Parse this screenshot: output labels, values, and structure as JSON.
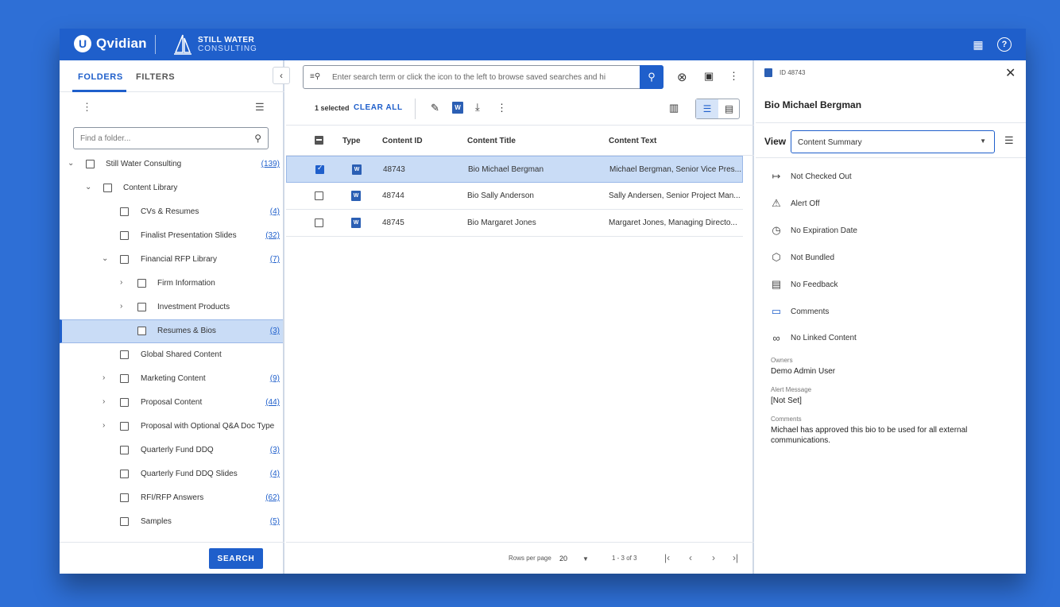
{
  "topbar": {
    "brand": "Qvidian",
    "brand_mark": "U",
    "client_line1": "STILL WATER",
    "client_line2": "CONSULTING",
    "icons": [
      "building-icon",
      "help-icon"
    ]
  },
  "left": {
    "tabs": [
      "FOLDERS",
      "FILTERS"
    ],
    "find_placeholder": "Find a folder...",
    "tree": [
      {
        "label": "Still Water Consulting",
        "count": "(139)",
        "chev": "⌄"
      },
      {
        "label": "Content Library",
        "count": "",
        "chev": "⌄"
      },
      {
        "label": "CVs & Resumes",
        "count": "(4)",
        "chev": ""
      },
      {
        "label": "Finalist Presentation Slides",
        "count": "(32)",
        "chev": ""
      },
      {
        "label": "Financial RFP Library",
        "count": "(7)",
        "chev": "⌄"
      },
      {
        "label": "Firm Information",
        "count": "",
        "chev": "›"
      },
      {
        "label": "Investment Products",
        "count": "",
        "chev": "›"
      },
      {
        "label": "Resumes & Bios",
        "count": "(3)",
        "chev": ""
      },
      {
        "label": "Global Shared Content",
        "count": "",
        "chev": ""
      },
      {
        "label": "Marketing Content",
        "count": "(9)",
        "chev": "›"
      },
      {
        "label": "Proposal Content",
        "count": "(44)",
        "chev": "›"
      },
      {
        "label": "Proposal with Optional Q&A Doc Type",
        "count": "",
        "chev": "›"
      },
      {
        "label": "Quarterly Fund DDQ",
        "count": "(3)",
        "chev": ""
      },
      {
        "label": "Quarterly Fund DDQ Slides",
        "count": "(4)",
        "chev": ""
      },
      {
        "label": "RFI/RFP Answers",
        "count": "(62)",
        "chev": ""
      },
      {
        "label": "Samples",
        "count": "(5)",
        "chev": ""
      }
    ],
    "search_button": "SEARCH"
  },
  "middle": {
    "search_placeholder": "Enter search term or click the icon to the left to browse saved searches and hi",
    "selected_count": "1 selected",
    "clear_all": "CLEAR ALL",
    "columns": [
      "Type",
      "Content ID",
      "Content Title",
      "Content Text"
    ],
    "rows": [
      {
        "id": "48743",
        "title": "Bio Michael Bergman",
        "text": "Michael Bergman, Senior Vice Pres...",
        "selected": true
      },
      {
        "id": "48744",
        "title": "Bio Sally Anderson",
        "text": "Sally Andersen, Senior Project Man...",
        "selected": false
      },
      {
        "id": "48745",
        "title": "Bio Margaret Jones",
        "text": "Margaret Jones, Managing Directo...",
        "selected": false
      }
    ],
    "pager": {
      "rows_per_page_label": "Rows per page",
      "rows_per_page": "20",
      "range": "1 - 3 of 3"
    }
  },
  "right": {
    "id_label": "ID 48743",
    "title": "Bio Michael Bergman",
    "view_label": "View",
    "view_value": "Content Summary",
    "statuses": [
      {
        "icon": "checkout-icon",
        "glyph": "↦",
        "label": "Not Checked Out"
      },
      {
        "icon": "alert-icon",
        "glyph": "⚠",
        "label": "Alert Off"
      },
      {
        "icon": "clock-icon",
        "glyph": "◷",
        "label": "No Expiration Date"
      },
      {
        "icon": "bundle-icon",
        "glyph": "⬡",
        "label": "Not Bundled"
      },
      {
        "icon": "feedback-icon",
        "glyph": "▤",
        "label": "No Feedback"
      },
      {
        "icon": "comment-icon",
        "glyph": "▭",
        "label": "Comments"
      },
      {
        "icon": "link-icon",
        "glyph": "∞",
        "label": "No Linked Content"
      }
    ],
    "owners_label": "Owners",
    "owners_value": "Demo Admin User",
    "alert_label": "Alert Message",
    "alert_value": "[Not Set]",
    "comments_label": "Comments",
    "comments_value": "Michael has approved this bio to be used for all external communications."
  },
  "colors": {
    "accent": "#1f5fcb",
    "background": "#2e6fd6",
    "selection": "#c9dcf6"
  }
}
